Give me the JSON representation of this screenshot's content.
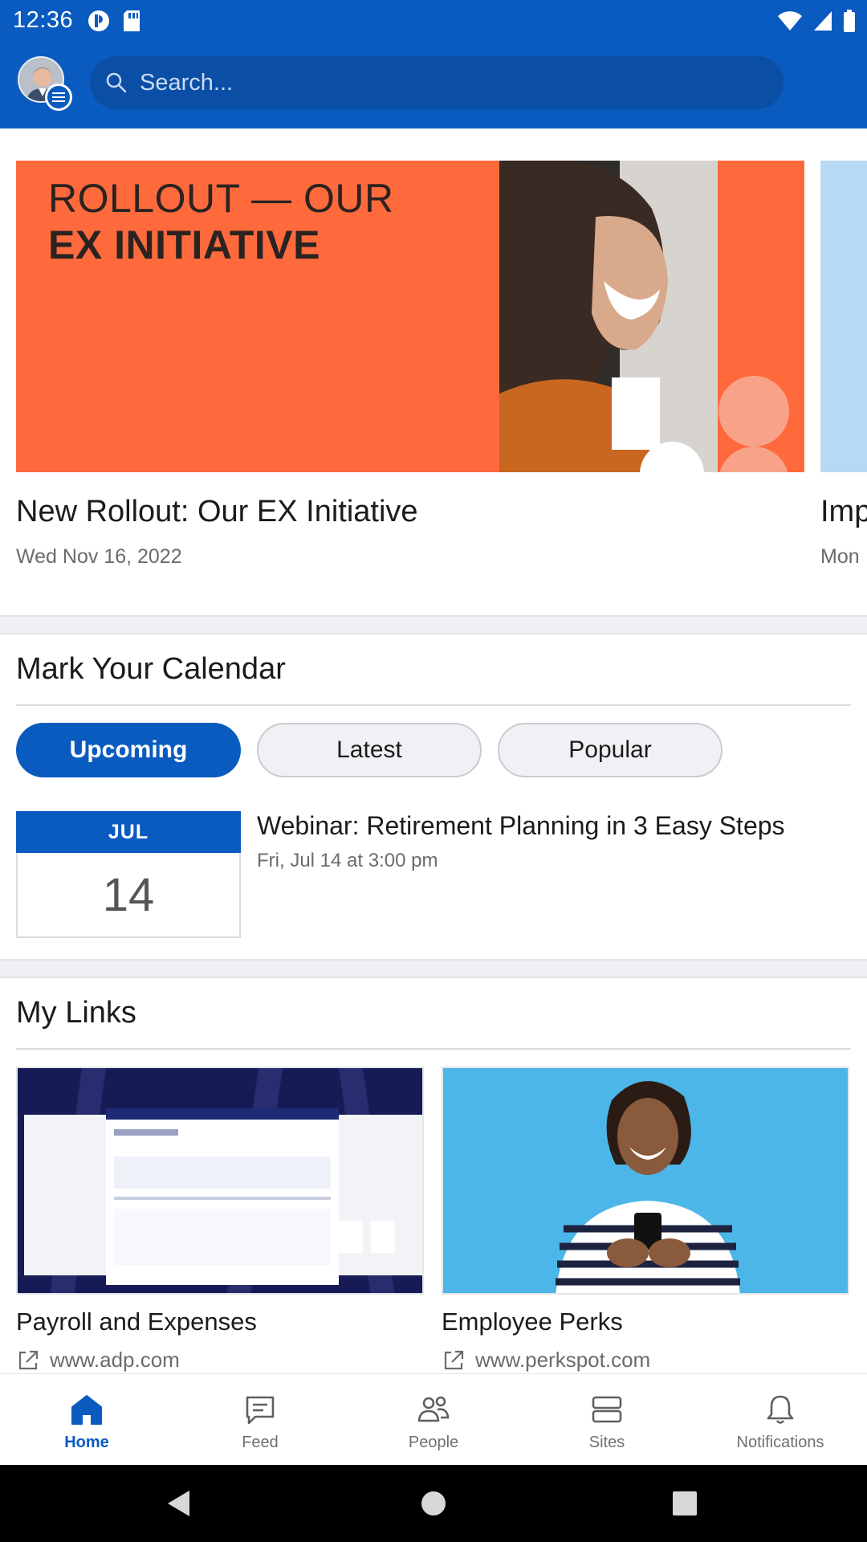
{
  "status_bar": {
    "time": "12:36"
  },
  "header": {
    "search_placeholder": "Search...",
    "colors": {
      "brand": "#0a5bbf",
      "search_bg": "#0b4ea6"
    }
  },
  "news": [
    {
      "banner_lines": [
        "ROLLOUT — OUR",
        "EX INITIATIVE"
      ],
      "title": "New Rollout: Our EX Initiative",
      "date": "Wed Nov 16, 2022"
    },
    {
      "title": "Imp",
      "date": "Mon"
    }
  ],
  "calendar": {
    "title": "Mark Your Calendar",
    "tabs": [
      {
        "label": "Upcoming",
        "selected": true
      },
      {
        "label": "Latest",
        "selected": false
      },
      {
        "label": "Popular",
        "selected": false
      }
    ],
    "events": [
      {
        "month": "JUL",
        "day": "14",
        "title": "Webinar: Retirement Planning in 3 Easy Steps",
        "time": "Fri, Jul 14 at 3:00 pm"
      }
    ]
  },
  "links": {
    "title": "My Links",
    "items": [
      {
        "title": "Payroll and Expenses",
        "url": "www.adp.com",
        "icon": "external-link-icon"
      },
      {
        "title": "Employee Perks",
        "url": "www.perkspot.com",
        "icon": "external-link-icon"
      }
    ]
  },
  "bottom_nav": {
    "items": [
      {
        "label": "Home",
        "icon": "home-icon",
        "active": true
      },
      {
        "label": "Feed",
        "icon": "chat-icon",
        "active": false
      },
      {
        "label": "People",
        "icon": "people-icon",
        "active": false
      },
      {
        "label": "Sites",
        "icon": "sites-icon",
        "active": false
      },
      {
        "label": "Notifications",
        "icon": "bell-icon",
        "active": false
      }
    ]
  }
}
